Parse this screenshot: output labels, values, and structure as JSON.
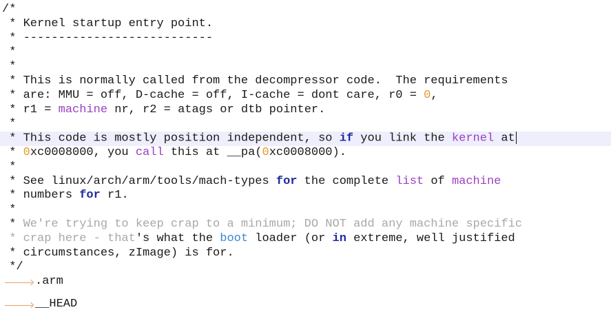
{
  "editor": {
    "comment_open": "/*",
    "comment_close": " */",
    "star": " * ",
    "star_bare": " *",
    "l1": "Kernel startup entry point.",
    "l2": "---------------------------",
    "l3": [
      {
        "t": "This is normally called from the decompressor code.  The requirements",
        "c": ""
      }
    ],
    "l4": [
      {
        "t": "are: MMU = off, D-cache = off, I-cache = dont care, r0 = ",
        "c": ""
      },
      {
        "t": "0",
        "c": "num"
      },
      {
        "t": ",",
        "c": ""
      }
    ],
    "l5": [
      {
        "t": "r1 = ",
        "c": ""
      },
      {
        "t": "machine",
        "c": "id"
      },
      {
        "t": " nr, r2 = atags or dtb pointer.",
        "c": ""
      }
    ],
    "l6": [
      {
        "t": "This code is mostly position independent, so ",
        "c": ""
      },
      {
        "t": "if",
        "c": "kw"
      },
      {
        "t": " you link the ",
        "c": ""
      },
      {
        "t": "kernel",
        "c": "id"
      },
      {
        "t": " at",
        "c": ""
      }
    ],
    "l7": [
      {
        "t": "0",
        "c": "num"
      },
      {
        "t": "xc0008000, you ",
        "c": ""
      },
      {
        "t": "call",
        "c": "id"
      },
      {
        "t": " this at __pa(",
        "c": ""
      },
      {
        "t": "0",
        "c": "num"
      },
      {
        "t": "xc0008000).",
        "c": ""
      }
    ],
    "l8": [
      {
        "t": "See linux/arch/arm/tools/mach-types ",
        "c": ""
      },
      {
        "t": "for",
        "c": "kw"
      },
      {
        "t": " the complete ",
        "c": ""
      },
      {
        "t": "list",
        "c": "id"
      },
      {
        "t": " of ",
        "c": ""
      },
      {
        "t": "machine",
        "c": "id"
      }
    ],
    "l9": [
      {
        "t": "numbers ",
        "c": ""
      },
      {
        "t": "for",
        "c": "kw"
      },
      {
        "t": " r1.",
        "c": ""
      }
    ],
    "l10": [
      {
        "t": "We're trying to keep crap to a minimum; DO NOT add any machine specific",
        "c": "fade"
      }
    ],
    "l11": [
      {
        "t": "crap here - that",
        "c": "fade"
      },
      {
        "t": "'s what the ",
        "c": ""
      },
      {
        "t": "boot",
        "c": "blue"
      },
      {
        "t": " loader (or ",
        "c": ""
      },
      {
        "t": "in",
        "c": "kw"
      },
      {
        "t": " extreme, well justified",
        "c": ""
      }
    ],
    "l12": [
      {
        "t": "circumstances, zImage) is for.",
        "c": ""
      }
    ],
    "directive1": ".arm",
    "directive2": "__HEAD"
  },
  "colors": {
    "keyword": "#1f2a9e",
    "identifier": "#9a3fc3",
    "number": "#e59a2c",
    "boot": "#3a88d6",
    "current_line": "#eeeefc",
    "tab_arrow": "#e8a06a"
  }
}
